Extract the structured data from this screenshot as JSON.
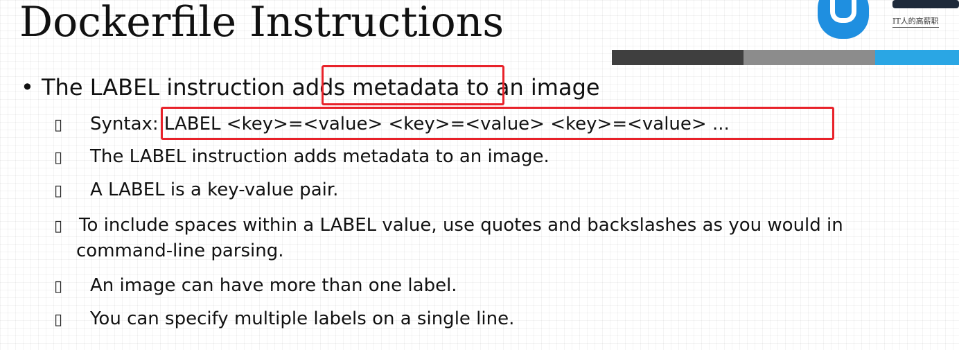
{
  "slide": {
    "title": "Dockerfile Instructions",
    "logo": {
      "subtitle": "IT人的高薪职"
    },
    "main_bullet": {
      "marker": "•",
      "text": "The LABEL instruction adds metadata to an image"
    },
    "sub_marker": "▯",
    "items": [
      {
        "text": "Syntax: LABEL <key>=<value> <key>=<value> <key>=<value> ..."
      },
      {
        "text": "The LABEL instruction adds metadata to an image."
      },
      {
        "text": "A LABEL is a key-value pair."
      },
      {
        "text": "To include spaces within a LABEL value, use quotes and backslashes as you would in",
        "continuation": "command-line parsing."
      },
      {
        "text": "An image can have more than one label."
      },
      {
        "text": "You can specify multiple labels on a single line."
      }
    ],
    "colors": {
      "highlight": "#e8222a",
      "bar_dark": "#3f3f3f",
      "bar_gray": "#8c8c8c",
      "bar_blue": "#2aa6e4",
      "logo_blue": "#1f8fe0"
    }
  }
}
